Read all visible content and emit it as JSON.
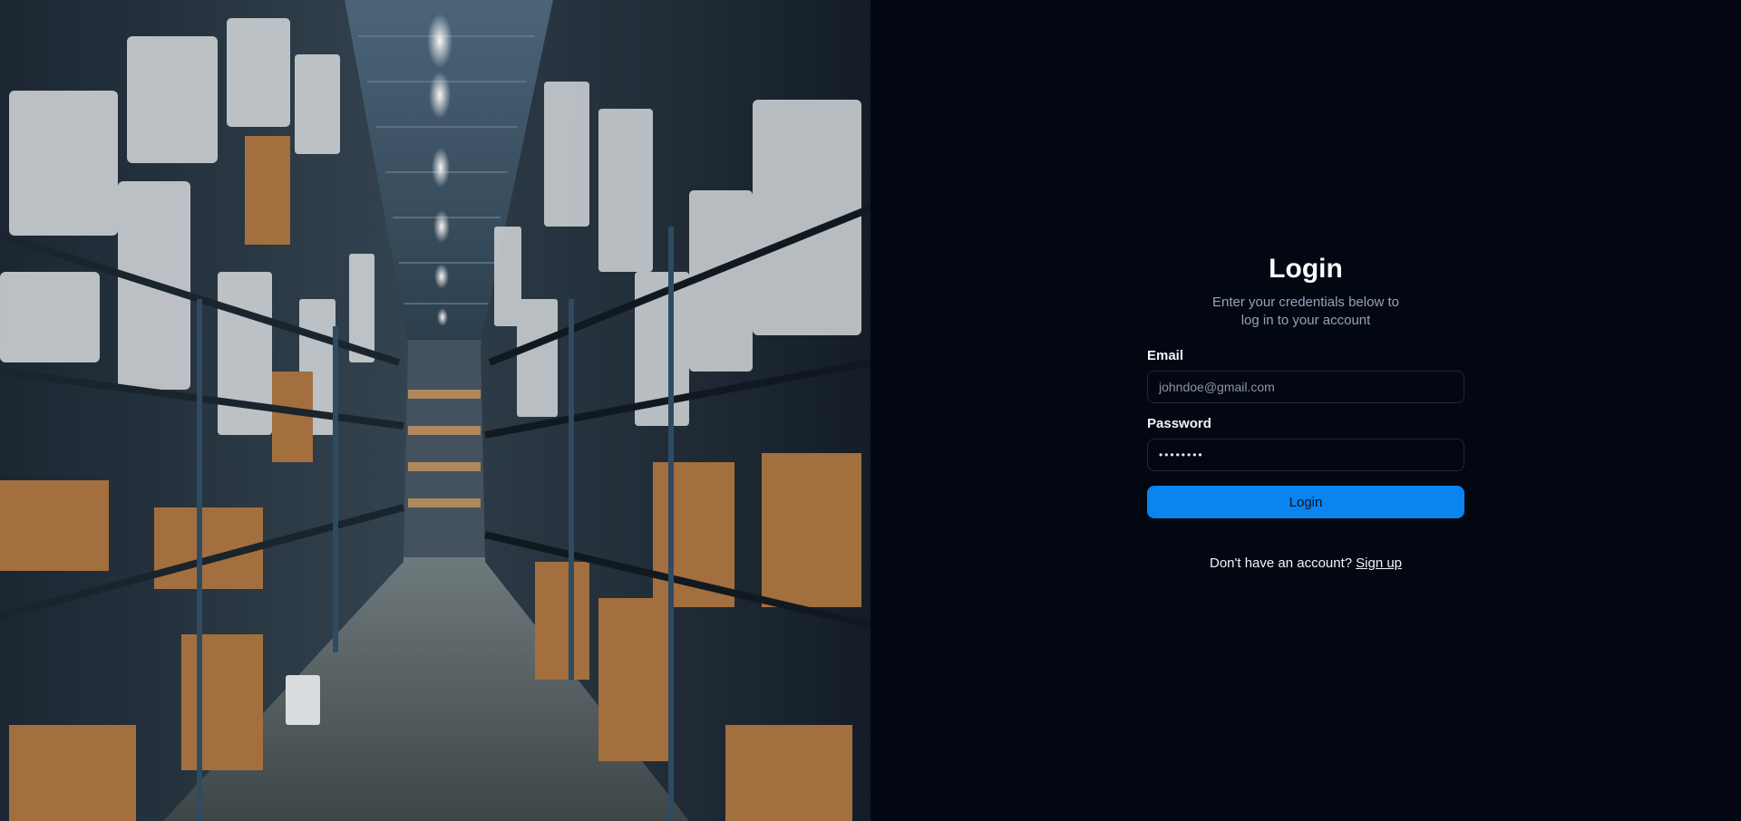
{
  "hero": {
    "image_subject": "warehouse-aisle"
  },
  "login": {
    "title": "Login",
    "subtitle": "Enter your credentials below to log in to your account",
    "email_label": "Email",
    "email_placeholder": "johndoe@gmail.com",
    "email_value": "",
    "password_label": "Password",
    "password_value": "password",
    "submit_label": "Login",
    "signup_prompt": "Don't have an account?",
    "signup_link": "Sign up"
  },
  "colors": {
    "background": "#030712",
    "accent": "#0a84ee",
    "muted_text": "#94a3b8",
    "input_border": "#1f2937"
  }
}
